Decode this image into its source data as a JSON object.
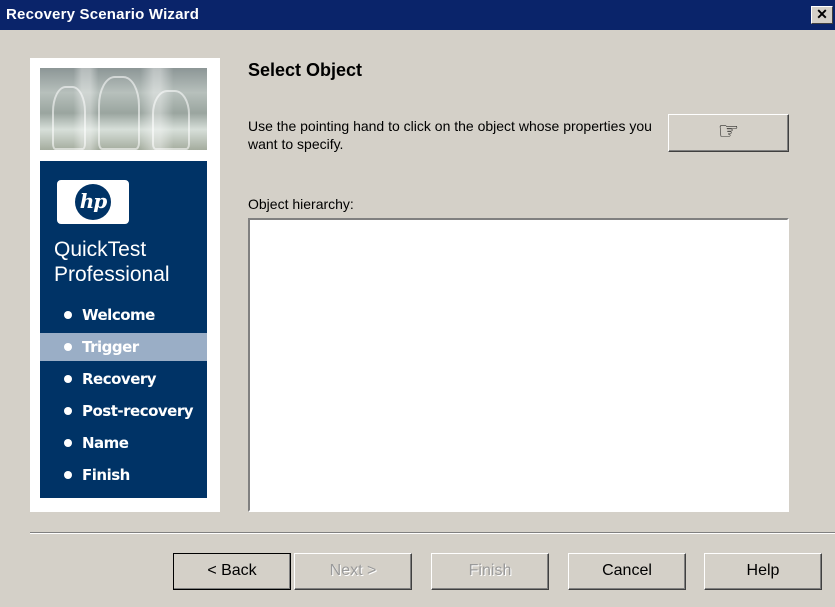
{
  "window": {
    "title": "Recovery Scenario Wizard",
    "close_label": "✕"
  },
  "sidebar": {
    "logo_text": "hp",
    "product_line1": "QuickTest",
    "product_line2": "Professional",
    "steps": [
      {
        "label": "Welcome",
        "active": false
      },
      {
        "label": "Trigger",
        "active": true
      },
      {
        "label": "Recovery",
        "active": false
      },
      {
        "label": "Post-recovery",
        "active": false
      },
      {
        "label": "Name",
        "active": false
      },
      {
        "label": "Finish",
        "active": false
      }
    ]
  },
  "main": {
    "heading": "Select Object",
    "instruction": "Use the pointing hand to click on the object whose properties you want to specify.",
    "pointing_hand_icon": "☞",
    "hierarchy_label": "Object hierarchy:"
  },
  "buttons": {
    "back": "< Back",
    "next": "Next >",
    "finish": "Finish",
    "cancel": "Cancel",
    "help": "Help"
  }
}
